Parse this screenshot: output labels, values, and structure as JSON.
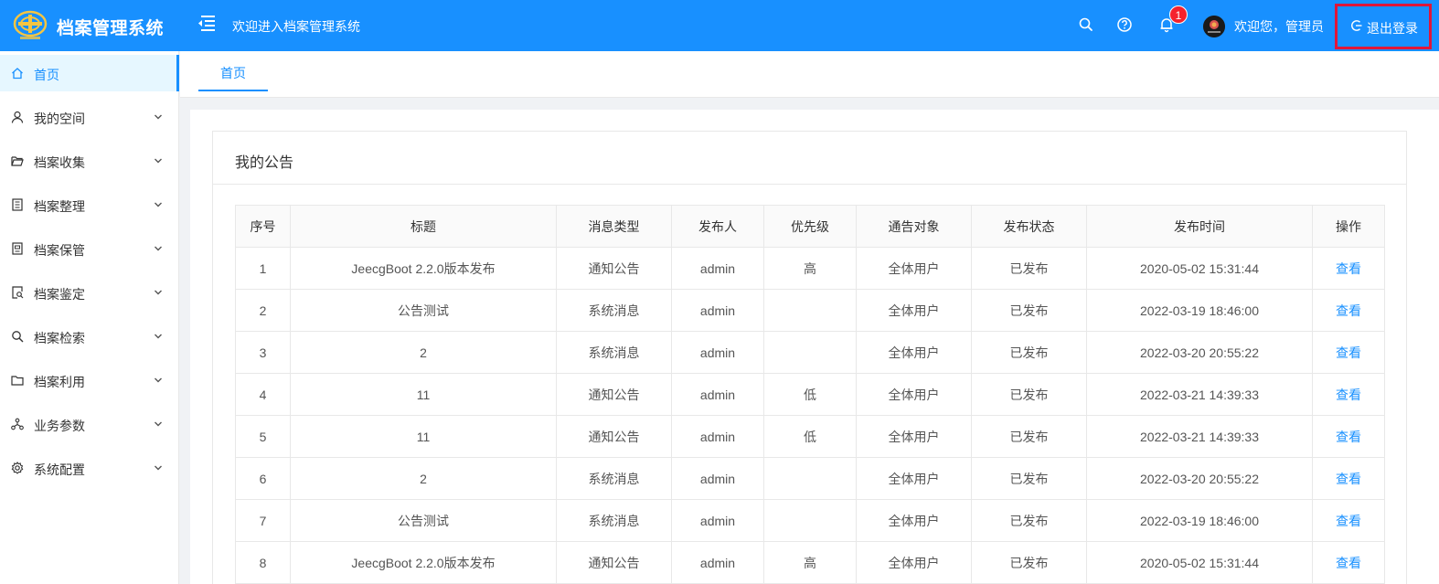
{
  "header": {
    "app_title": "档案管理系统",
    "welcome": "欢迎进入档案管理系统",
    "notification_count": "1",
    "user_greeting": "欢迎您，管理员",
    "logout_label": "退出登录",
    "accent_color": "#1890ff"
  },
  "sidebar": {
    "items": [
      {
        "label": "首页",
        "icon": "home-icon"
      },
      {
        "label": "我的空间",
        "icon": "user-icon"
      },
      {
        "label": "档案收集",
        "icon": "folder-open-icon"
      },
      {
        "label": "档案整理",
        "icon": "file-list-icon"
      },
      {
        "label": "档案保管",
        "icon": "file-box-icon"
      },
      {
        "label": "档案鉴定",
        "icon": "file-search-icon"
      },
      {
        "label": "档案检索",
        "icon": "search-icon"
      },
      {
        "label": "档案利用",
        "icon": "folder-icon"
      },
      {
        "label": "业务参数",
        "icon": "cluster-icon"
      },
      {
        "label": "系统配置",
        "icon": "gear-icon"
      }
    ]
  },
  "tabs": [
    {
      "label": "首页"
    }
  ],
  "card": {
    "title": "我的公告",
    "columns": [
      "序号",
      "标题",
      "消息类型",
      "发布人",
      "优先级",
      "通告对象",
      "发布状态",
      "发布时间",
      "操作"
    ],
    "rows": [
      [
        "1",
        "JeecgBoot 2.2.0版本发布",
        "通知公告",
        "admin",
        "高",
        "全体用户",
        "已发布",
        "2020-05-02 15:31:44",
        "查看"
      ],
      [
        "2",
        "公告测试",
        "系统消息",
        "admin",
        "",
        "全体用户",
        "已发布",
        "2022-03-19 18:46:00",
        "查看"
      ],
      [
        "3",
        "2",
        "系统消息",
        "admin",
        "",
        "全体用户",
        "已发布",
        "2022-03-20 20:55:22",
        "查看"
      ],
      [
        "4",
        "11",
        "通知公告",
        "admin",
        "低",
        "全体用户",
        "已发布",
        "2022-03-21 14:39:33",
        "查看"
      ],
      [
        "5",
        "11",
        "通知公告",
        "admin",
        "低",
        "全体用户",
        "已发布",
        "2022-03-21 14:39:33",
        "查看"
      ],
      [
        "6",
        "2",
        "系统消息",
        "admin",
        "",
        "全体用户",
        "已发布",
        "2022-03-20 20:55:22",
        "查看"
      ],
      [
        "7",
        "公告测试",
        "系统消息",
        "admin",
        "",
        "全体用户",
        "已发布",
        "2022-03-19 18:46:00",
        "查看"
      ],
      [
        "8",
        "JeecgBoot 2.2.0版本发布",
        "通知公告",
        "admin",
        "高",
        "全体用户",
        "已发布",
        "2020-05-02 15:31:44",
        "查看"
      ]
    ]
  }
}
